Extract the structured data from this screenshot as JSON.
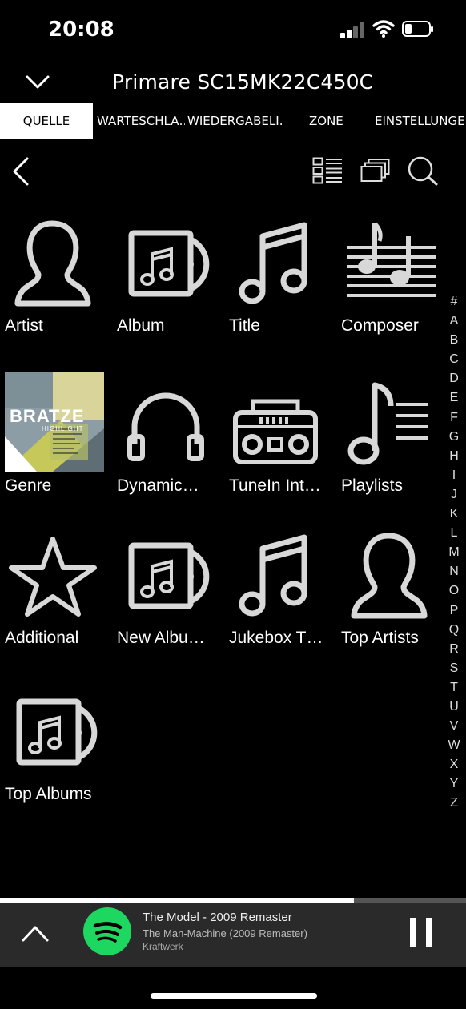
{
  "status_bar": {
    "time": "20:08"
  },
  "header": {
    "device_title": "Primare SC15MK22C450C"
  },
  "tabs": [
    {
      "label": "QUELLE",
      "active": true
    },
    {
      "label": "WARTESCHLA…",
      "active": false
    },
    {
      "label": "WIEDERGABELI…",
      "active": false
    },
    {
      "label": "ZONE",
      "active": false
    },
    {
      "label": "EINSTELLUNGEN",
      "active": false
    }
  ],
  "toolbar": {
    "back_icon": "chevron-left-icon",
    "list_view_icon": "list-view-icon",
    "stack_icon": "stack-icon",
    "search_icon": "search-icon"
  },
  "categories": [
    {
      "label": "Artist",
      "icon": "artist-icon"
    },
    {
      "label": "Album",
      "icon": "album-icon"
    },
    {
      "label": "Title",
      "icon": "music-note-icon"
    },
    {
      "label": "Composer",
      "icon": "sheet-music-icon"
    },
    {
      "label": "Genre",
      "icon": "genre-artwork"
    },
    {
      "label": "Dynamic…",
      "icon": "headphones-icon"
    },
    {
      "label": "TuneIn Int…",
      "icon": "radio-icon"
    },
    {
      "label": "Playlists",
      "icon": "playlist-icon"
    },
    {
      "label": "Additional",
      "icon": "star-icon"
    },
    {
      "label": "New Albu…",
      "icon": "album-icon"
    },
    {
      "label": "Jukebox T…",
      "icon": "music-note-icon"
    },
    {
      "label": "Top Artists",
      "icon": "artist-icon"
    },
    {
      "label": "Top Albums",
      "icon": "album-icon"
    }
  ],
  "genre_artwork": {
    "title": "BRATZE",
    "subtitle": "HIGHLIGHT"
  },
  "alpha_index": [
    "#",
    "A",
    "B",
    "C",
    "D",
    "E",
    "F",
    "G",
    "H",
    "I",
    "J",
    "K",
    "L",
    "M",
    "N",
    "O",
    "P",
    "Q",
    "R",
    "S",
    "T",
    "U",
    "V",
    "W",
    "X",
    "Y",
    "Z"
  ],
  "now_playing": {
    "title": "The Model - 2009 Remaster",
    "album": "The Man-Machine (2009 Remaster)",
    "artist": "Kraftwerk",
    "source_icon": "spotify-icon",
    "progress": 0.76,
    "state": "playing"
  },
  "colors": {
    "background": "#000000",
    "foreground": "#ffffff",
    "icon_gray": "#d8d8d8",
    "player_bg": "#2a2a2a",
    "spotify_green": "#1ed760"
  }
}
